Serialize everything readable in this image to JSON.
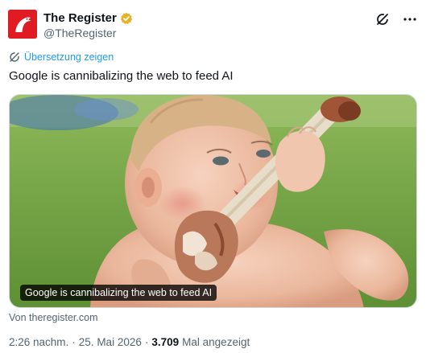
{
  "author": {
    "display_name": "The Register",
    "handle": "@TheRegister",
    "avatar_icon": "register-vulture-logo-icon",
    "verified_icon": "verified-gold-badge-icon"
  },
  "header_icons": [
    "grok-icon",
    "more-options-icon"
  ],
  "translate": {
    "label": "Übersetzung zeigen",
    "icon": "translate-globe-icon"
  },
  "tweet": {
    "text": "Google is cannibalizing the web to feed AI"
  },
  "media": {
    "caption": "Google is cannibalizing the web to feed AI",
    "subject": "baby gnawing on a large meat bone"
  },
  "link_source": "Von theregister.com",
  "meta": {
    "time": "2:26 nachm.",
    "separator": "·",
    "date": "25. Mai 2026",
    "views_count": "3.709",
    "views_label": "Mal angezeigt"
  },
  "colors": {
    "link_blue": "#1d9bf0",
    "secondary_text": "#536471",
    "register_red": "#e01b24",
    "verified_gold": "#e8b127"
  }
}
